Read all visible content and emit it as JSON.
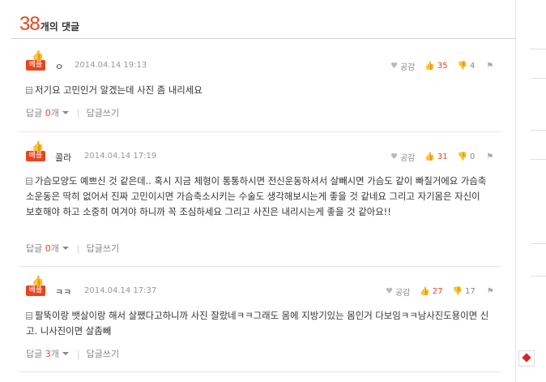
{
  "header": {
    "count": "38",
    "count_label": "개의 댓글"
  },
  "badge_label": "베플",
  "like_label": "공감",
  "reply_label": "답글",
  "reply_unit": "개",
  "write_reply_label": "답글쓰기",
  "comments": [
    {
      "author": "ㅇ",
      "date": "2014.04.14 19:13",
      "up": "35",
      "down": "4",
      "text": "저기요 고민인거 알겠는데 사진 좀 내리세요",
      "reply_count": "0"
    },
    {
      "author": "콜라",
      "date": "2014.04.14 17:19",
      "up": "31",
      "down": "0",
      "text": "가슴모양도 예쁘신 것 같은데.. 혹시 지금 체형이 통통하시면 전신운동하셔서 살빼시면 가슴도 같이 빠질거에요 가슴축소운동은 딱히 없어서 진짜 고민이시면 가슴축소시키는 수술도 생각해보시는게 좋을 것 같네요 그리고 자기몸은 자신이 보호해야 하고 소중히 여겨야 하니까 꼭 조심하세요 그리고 사진은 내리시는게 좋을 것 같아요!!",
      "reply_count": "0"
    },
    {
      "author": "ㅋㅋ",
      "date": "2014.04.14 17:37",
      "up": "27",
      "down": "17",
      "text": "팔뚝이랑 뱃살이랑 해서 살쨌다고하니까 사진 잘랐네ㅋㅋ그래도 몸에 지방기있는 몸인거 다보임ㅋㅋ남사진도용이면 신고. 니사진이면 살좀빼",
      "reply_count": "3"
    }
  ],
  "colors": {
    "accent": "#e8451e"
  },
  "icons": [
    "thumb-up-icon",
    "heart-icon",
    "thumb-down-icon",
    "report-icon",
    "document-icon",
    "dropdown-caret-icon",
    "scroll-top-icon"
  ]
}
